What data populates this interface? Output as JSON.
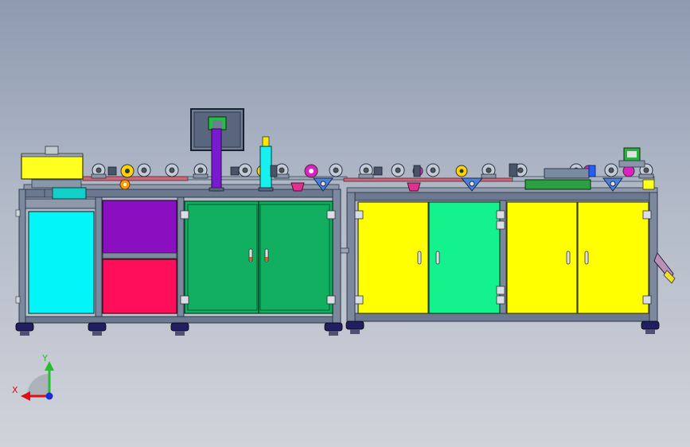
{
  "triad": {
    "y_label": "Y",
    "x_label": "X",
    "colors": {
      "y": "#22c02a",
      "x": "#e01010",
      "z": "#1a2bd8"
    }
  },
  "colors": {
    "background_top": "#8e9ab0",
    "background_bottom": "#d0d3da",
    "cyan_panel": "#00f6f8",
    "purple_panel": "#8a0fc0",
    "crimson_panel": "#ff0f5a",
    "green_door": "#10b060",
    "yellow_door": "#ffff00",
    "mint_door": "#14f28e",
    "frame": "#5f6f86",
    "conveyor_belt": "#c86a78",
    "feet": "#202060"
  }
}
